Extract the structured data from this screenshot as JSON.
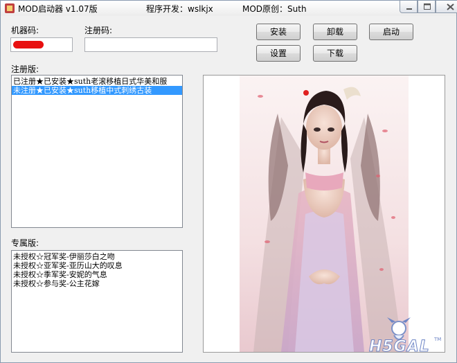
{
  "window": {
    "app_name": "MOD启动器 v1.07版",
    "developer": "程序开发：wslkjx",
    "original": "MOD原创：Suth"
  },
  "fields": {
    "machine_code_label": "机器码:",
    "machine_code_value": "",
    "reg_code_label": "注册码:",
    "reg_code_value": ""
  },
  "buttons": {
    "install": "安装",
    "uninstall": "卸载",
    "launch": "启动",
    "settings": "设置",
    "download": "下载"
  },
  "registered": {
    "label": "注册版:",
    "items": [
      "已注册★已安装★suth老滚移植日式华美和服",
      "未注册★已安装★suth移植中式刺绣古装"
    ],
    "selected_index": 1
  },
  "exclusive": {
    "label": "专属版:",
    "items": [
      "未授权☆冠军奖-伊丽莎白之吻",
      "未授权☆亚军奖-亚历山大的叹息",
      "未授权☆季军奖-安妮的气息",
      "未授权☆参与奖-公主花嫁"
    ]
  },
  "preview": {
    "watermark_text": "H5GAL",
    "watermark_tm": "TM"
  },
  "colors": {
    "selection": "#3399ff",
    "redaction": "#e81010",
    "window_bg": "#f0f0f0"
  }
}
